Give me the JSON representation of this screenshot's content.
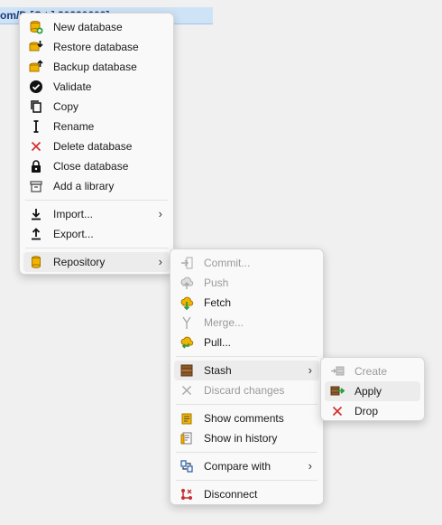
{
  "window": {
    "title_fragment": "om/D                  [C   t ]  20230609]"
  },
  "main_menu": {
    "items": [
      {
        "label": "New database",
        "icon": "database-add-icon"
      },
      {
        "label": "Restore database",
        "icon": "database-restore-icon"
      },
      {
        "label": "Backup database",
        "icon": "database-backup-icon"
      },
      {
        "label": "Validate",
        "icon": "check-circle-icon"
      },
      {
        "label": "Copy",
        "icon": "copy-icon"
      },
      {
        "label": "Rename",
        "icon": "text-cursor-icon"
      },
      {
        "label": "Delete database",
        "icon": "close-icon"
      },
      {
        "label": "Close database",
        "icon": "lock-icon"
      },
      {
        "label": "Add a library",
        "icon": "archive-icon"
      },
      {
        "label": "Import...",
        "icon": "import-icon"
      },
      {
        "label": "Export...",
        "icon": "export-icon"
      },
      {
        "label": "Repository",
        "icon": "repository-icon"
      }
    ]
  },
  "repository_menu": {
    "items": [
      {
        "label": "Commit...",
        "icon": "commit-icon",
        "disabled": true
      },
      {
        "label": "Push",
        "icon": "push-icon",
        "disabled": true
      },
      {
        "label": "Fetch",
        "icon": "fetch-icon",
        "disabled": false
      },
      {
        "label": "Merge...",
        "icon": "merge-icon",
        "disabled": true
      },
      {
        "label": "Pull...",
        "icon": "pull-icon",
        "disabled": false
      },
      {
        "label": "Stash",
        "icon": "stash-icon",
        "disabled": false
      },
      {
        "label": "Discard changes",
        "icon": "close-icon",
        "disabled": true
      },
      {
        "label": "Show comments",
        "icon": "comments-icon",
        "disabled": false
      },
      {
        "label": "Show in history",
        "icon": "history-icon",
        "disabled": false
      },
      {
        "label": "Compare with",
        "icon": "compare-icon",
        "disabled": false
      },
      {
        "label": "Disconnect",
        "icon": "disconnect-icon",
        "disabled": false
      }
    ]
  },
  "stash_menu": {
    "items": [
      {
        "label": "Create",
        "icon": "stash-create-icon",
        "disabled": true
      },
      {
        "label": "Apply",
        "icon": "stash-apply-icon",
        "disabled": false
      },
      {
        "label": "Drop",
        "icon": "close-icon",
        "disabled": false
      }
    ]
  },
  "colors": {
    "menu_bg": "#f9f9f9",
    "hover_bg": "#ececec",
    "disabled_text": "#9a9a9a",
    "delete_red": "#d42b2b",
    "db_yellow": "#f0b400"
  }
}
